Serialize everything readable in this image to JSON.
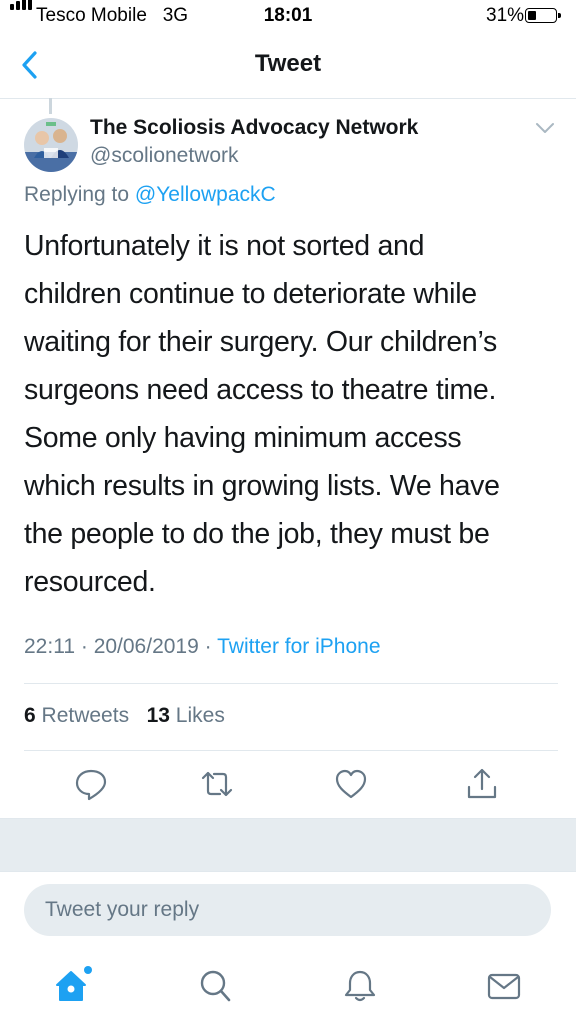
{
  "status_bar": {
    "carrier": "Tesco Mobile",
    "network": "3G",
    "time": "18:01",
    "battery_percent": "31%",
    "battery_level": 0.31,
    "signal_bars": 4
  },
  "nav": {
    "back_icon": "chevron-left-icon",
    "title": "Tweet"
  },
  "tweet": {
    "author_name": "The Scoliosis Advocacy Network",
    "author_handle": "@scolionetwork",
    "replying_prefix": "Replying to",
    "replying_to": "@YellowpackC",
    "text": "Unfortunately it is not sorted and\nchildren continue to deteriorate while\nwaiting for their surgery. Our children’s\nsurgeons need access to theatre time.\nSome only having minimum access\nwhich results in growing lists. We have\nthe people to do the job, they must be\nresourced.",
    "time": "22:11",
    "date": "20/06/2019",
    "separator": "·",
    "source": "Twitter for iPhone"
  },
  "stats": {
    "retweets_count": "6",
    "retweets_label": "Retweets",
    "likes_count": "13",
    "likes_label": "Likes"
  },
  "actions": [
    "reply-icon",
    "retweet-icon",
    "like-icon",
    "share-icon"
  ],
  "reply": {
    "placeholder": "Tweet your reply"
  },
  "tab_bar": [
    "home-icon",
    "search-icon",
    "notifications-icon",
    "messages-icon"
  ],
  "colors": {
    "accent": "#1da1f2",
    "text": "#14171a",
    "secondary": "#657786",
    "divider": "#e1e8ed",
    "gray_bg": "#e6ecf0"
  }
}
